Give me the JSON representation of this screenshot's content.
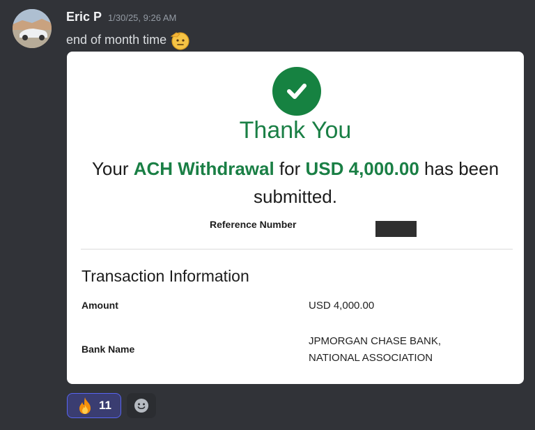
{
  "message": {
    "username": "Eric P",
    "timestamp": "1/30/25, 9:26 AM",
    "text": "end of month time",
    "text_emoji": "saluting-face-icon"
  },
  "card": {
    "check_icon": "checkmark-icon",
    "heading": "Thank You",
    "line_prefix": "Your ",
    "withdrawal_type": "ACH Withdrawal",
    "line_mid": " for ",
    "amount_highlight": "USD 4,000.00",
    "line_suffix": " has been submitted.",
    "reference_label": "Reference Number",
    "section_title": "Transaction Information",
    "rows": [
      {
        "label": "Amount",
        "value": "USD 4,000.00"
      },
      {
        "label": "Bank Name",
        "value_line1": "JPMORGAN CHASE BANK,",
        "value_line2": "NATIONAL ASSOCIATION"
      }
    ]
  },
  "reactions": {
    "fire_icon": "fire-icon",
    "fire_count": "11",
    "add_icon": "add-reaction-icon"
  },
  "colors": {
    "background": "#313338",
    "brand_green": "#1a7f45",
    "reaction_active": "#3a3d71",
    "reaction_border": "#5865f2"
  }
}
